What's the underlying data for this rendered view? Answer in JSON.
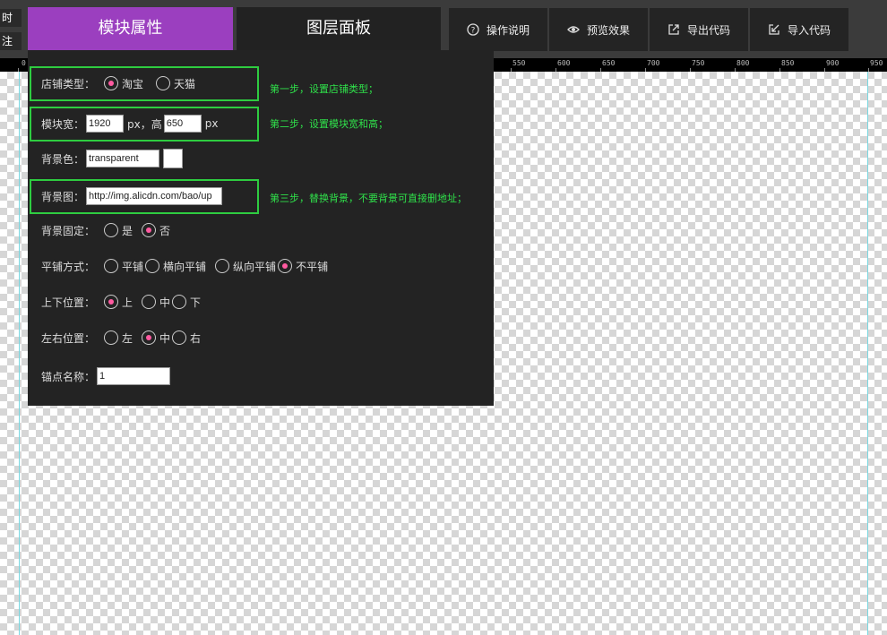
{
  "left_stubs": [
    "时",
    "注"
  ],
  "tabs": {
    "module_props": "模块属性",
    "layers": "图层面板"
  },
  "toolbar": {
    "help": "操作说明",
    "preview": "预览效果",
    "export": "导出代码",
    "import": "导入代码"
  },
  "ruler": [
    "0",
    "550",
    "600",
    "650",
    "700",
    "750",
    "800",
    "850",
    "900",
    "950"
  ],
  "form": {
    "shop_type": {
      "label": "店铺类型：",
      "options": [
        "淘宝",
        "天猫"
      ],
      "selected": "淘宝"
    },
    "size": {
      "label": "模块宽：",
      "width": "1920",
      "unit1": "px，高",
      "height": "650",
      "unit2": "px"
    },
    "bg_color": {
      "label": "背景色：",
      "value": "transparent"
    },
    "bg_image": {
      "label": "背景图：",
      "value": "http://img.alicdn.com/bao/up"
    },
    "bg_fixed": {
      "label": "背景固定：",
      "options": [
        "是",
        "否"
      ],
      "selected": "否"
    },
    "tile": {
      "label": "平铺方式：",
      "options": [
        "平铺",
        "横向平铺",
        "纵向平铺",
        "不平铺"
      ],
      "selected": "不平铺"
    },
    "v_pos": {
      "label": "上下位置：",
      "options": [
        "上",
        "中",
        "下"
      ],
      "selected": "上"
    },
    "h_pos": {
      "label": "左右位置：",
      "options": [
        "左",
        "中",
        "右"
      ],
      "selected": "中"
    },
    "anchor": {
      "label": "锚点名称：",
      "value": "1"
    }
  },
  "hints": {
    "step1": "第一步，设置店铺类型；",
    "step2": "第二步，设置模块宽和高；",
    "step3": "第三步，替换背景，不要背景可直接删地址；"
  },
  "colors": {
    "accent": "#9b3fbf",
    "hint": "#2fe04a",
    "radio_dot": "#ff5aa0",
    "guide": "#7ad7e0"
  }
}
